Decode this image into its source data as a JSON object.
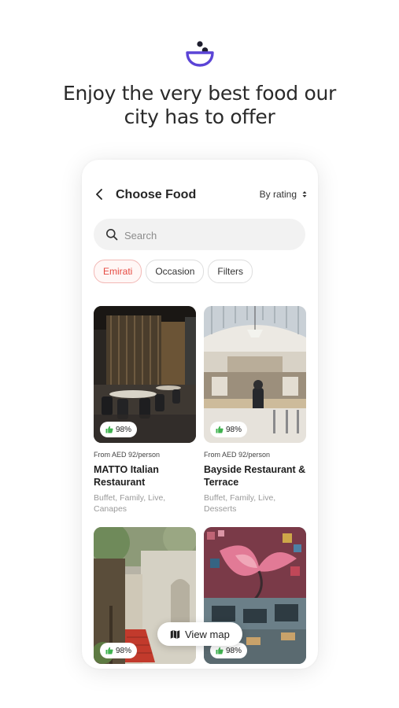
{
  "headline": {
    "line1": "Enjoy the very best food our",
    "line2": "city has to offer"
  },
  "brand": {
    "accent": "#5b44d6"
  },
  "app": {
    "title": "Choose Food",
    "sort_label": "By rating",
    "search": {
      "placeholder": "Search",
      "value": ""
    },
    "chips": [
      {
        "label": "Emirati",
        "active": true
      },
      {
        "label": "Occasion",
        "active": false
      },
      {
        "label": "Filters",
        "active": false
      }
    ],
    "restaurants": [
      {
        "rating": "98%",
        "price": "From AED 92/person",
        "name": "MATTO Italian Restaurant",
        "tags": "Buffet, Family, Live, Canapes"
      },
      {
        "rating": "98%",
        "price": "From AED 92/person",
        "name": "Bayside Restaurant & Terrace",
        "tags": "Buffet, Family, Live, Desserts"
      },
      {
        "rating": "98%"
      },
      {
        "rating": "98%"
      }
    ],
    "view_map_label": "View map",
    "colors": {
      "rating_green": "#3fb24f",
      "chip_active": "#e64b43"
    }
  }
}
